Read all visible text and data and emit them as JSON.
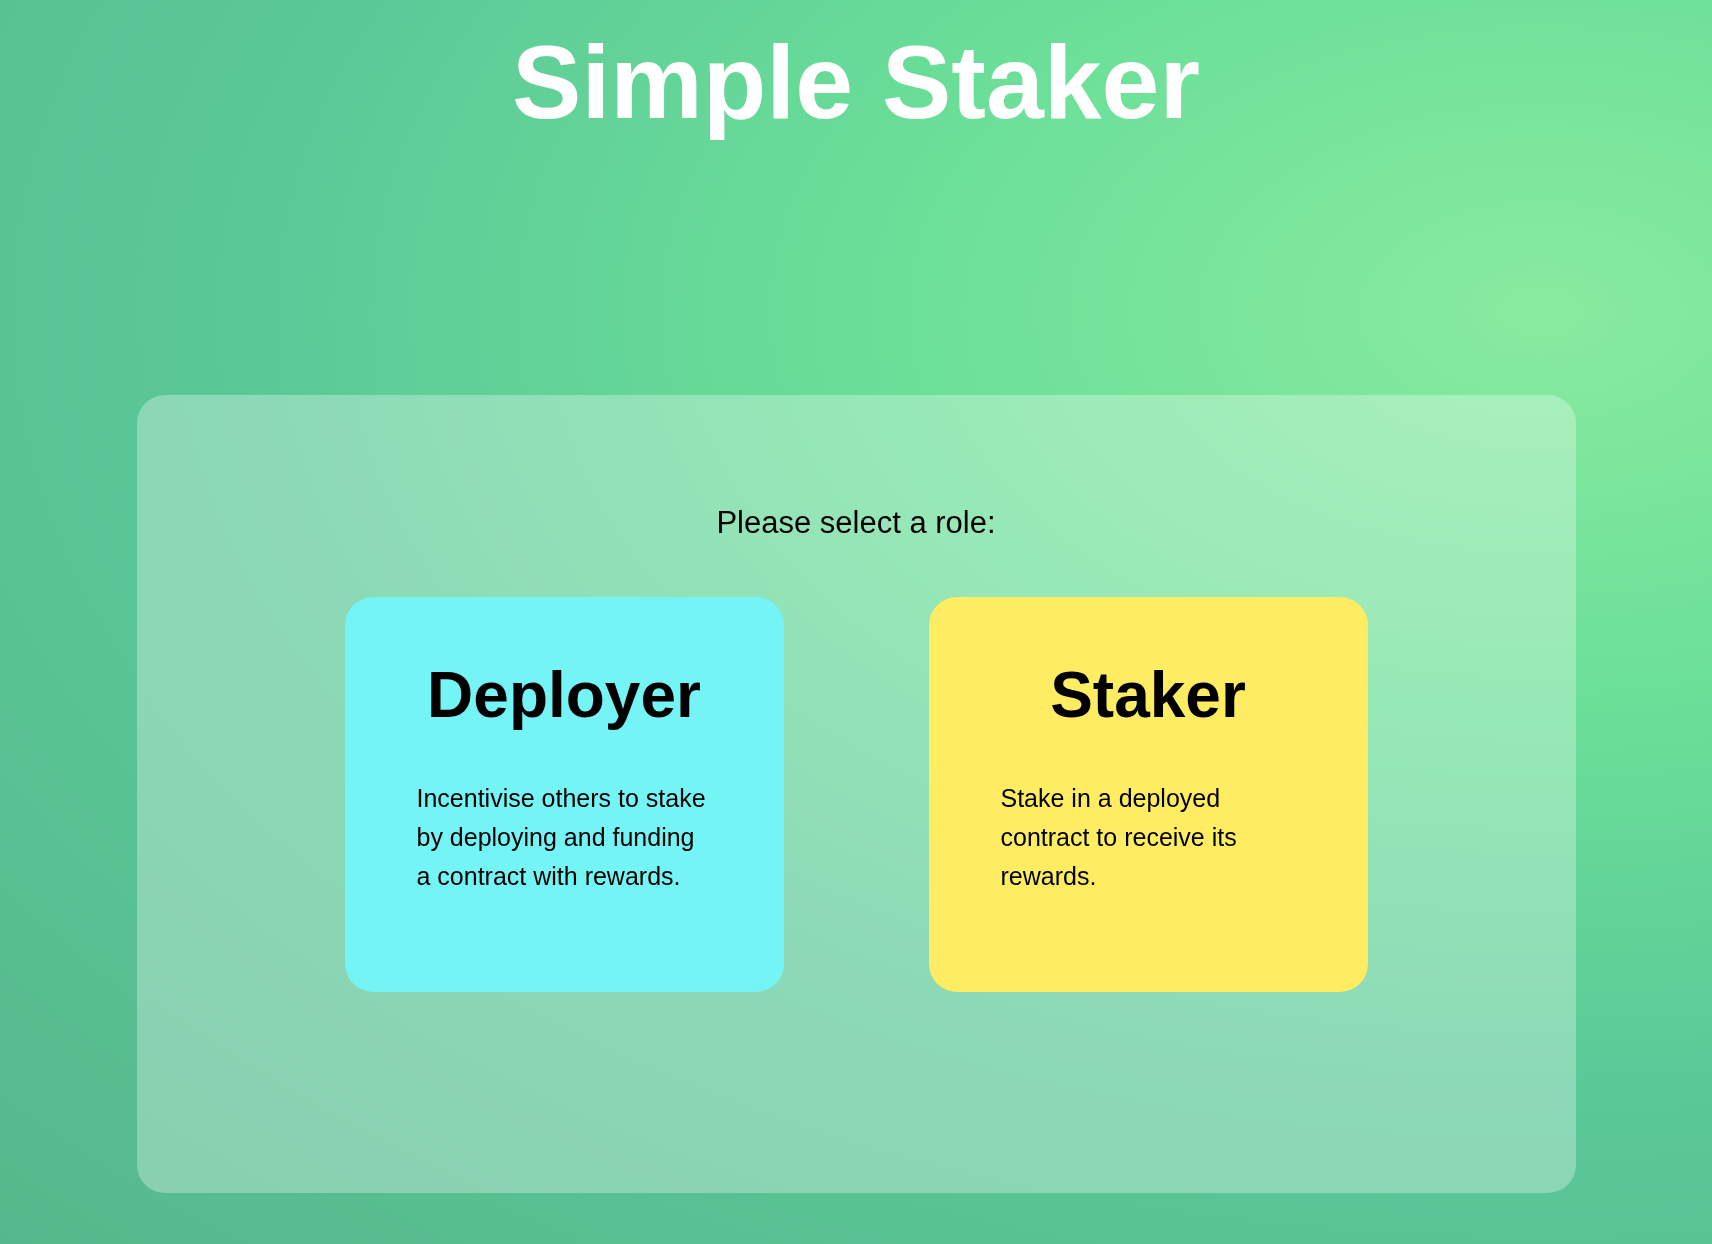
{
  "title": "Simple Staker",
  "prompt": "Please select a role:",
  "roles": [
    {
      "name": "Deployer",
      "description": "Incentivise others to stake by deploying and funding a contract with rewards.",
      "color": "#74f4f4"
    },
    {
      "name": "Staker",
      "description": "Stake in a deployed contract to receive its rewards.",
      "color": "#feec63"
    }
  ]
}
